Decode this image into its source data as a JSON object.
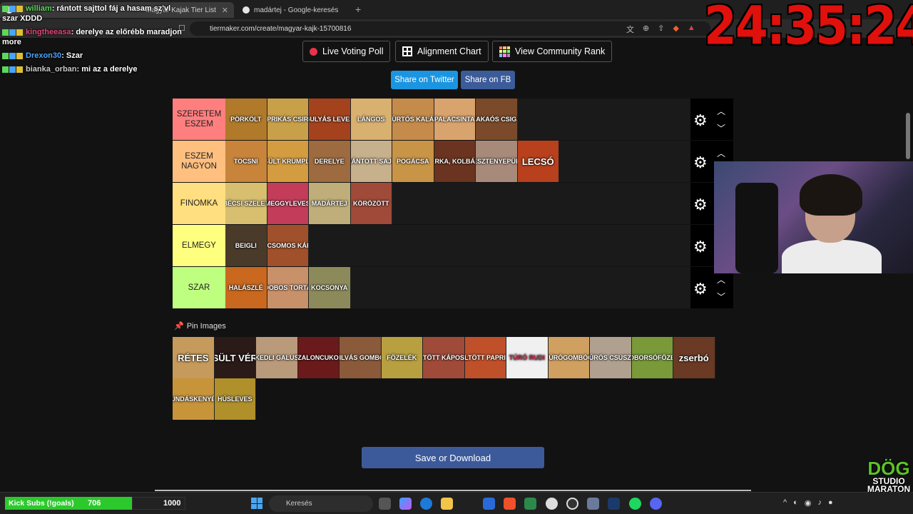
{
  "browser": {
    "tabs": [
      {
        "label": "Magyar Kajak Tier List",
        "active": true
      },
      {
        "label": "madártej - Google-keresés",
        "active": false
      }
    ],
    "url": "tiermaker.com/create/magyar-kajk-15700816"
  },
  "toolbar": {
    "live_voting": "Live Voting Poll",
    "alignment_chart": "Alignment Chart",
    "community_rank": "View Community Rank",
    "share_twitter": "Share on Twitter",
    "share_fb": "Share on FB",
    "twitter_color": "#1b95e0",
    "fb_color": "#3b5b99"
  },
  "tiers": [
    {
      "label": "SZERETEM ESZEM",
      "color": "#ff7f7f",
      "items": [
        {
          "text": "PÖRKÖLT",
          "bg": "#b07a2a"
        },
        {
          "text": "PRIKÁS CSIR",
          "bg": "#c9a04a"
        },
        {
          "text": "GULYÁS LEVES",
          "bg": "#a4421e"
        },
        {
          "text": "LÁNGOS",
          "bg": "#d8b070"
        },
        {
          "text": "KÜRTŐS KALÁC",
          "bg": "#c58b4b"
        },
        {
          "text": "PALACSINTA",
          "bg": "#d9a36d"
        },
        {
          "text": "KAKAÓS CSIGA",
          "bg": "#7a4a2a"
        }
      ]
    },
    {
      "label": "ESZEM NAGYON",
      "color": "#ffbf7f",
      "items": [
        {
          "text": "TOCSNI",
          "bg": "#c8843a"
        },
        {
          "text": "SÜLT KRUMPLI",
          "bg": "#d49c40"
        },
        {
          "text": "DERELYE",
          "bg": "#9e6a3f"
        },
        {
          "text": "RÁNTOTT SAJT",
          "bg": "#c7b08c"
        },
        {
          "text": "POGÁCSA",
          "bg": "#c89446"
        },
        {
          "text": "PÁRKA, KOLBÁSZ",
          "bg": "#6a3420"
        },
        {
          "text": "GESZTENYEPÜRÉ",
          "bg": "#a88a7a"
        },
        {
          "text": "LECSÓ",
          "bg": "#b8401c",
          "big": true
        }
      ]
    },
    {
      "label": "FINOMKA",
      "color": "#ffdf7f",
      "items": [
        {
          "text": "BÉCSI SZELET",
          "bg": "#d7bf6f"
        },
        {
          "text": "MEGGYLEVES",
          "bg": "#c33c5a"
        },
        {
          "text": "MADÁRTEJ",
          "bg": "#bfae7a"
        },
        {
          "text": "KÖRÖZÖTT",
          "bg": "#a04a3a"
        }
      ]
    },
    {
      "label": "ELMEGY",
      "color": "#ffff7f",
      "items": [
        {
          "text": "BEIGLI",
          "bg": "#4a3a2a"
        },
        {
          "text": "PARADICSOMOS KÁPOSZTA",
          "bg": "#a0502a"
        }
      ]
    },
    {
      "label": "SZAR",
      "color": "#bfff7f",
      "items": [
        {
          "text": "HALÁSZLÉ",
          "bg": "#c9681e"
        },
        {
          "text": "DOBOS TORTA",
          "bg": "#c9916a"
        },
        {
          "text": "KOCSONYA",
          "bg": "#8c8a5a"
        }
      ]
    }
  ],
  "pin_label": "Pin Images",
  "pool": [
    {
      "text": "RÉTES",
      "bg": "#c69a5a",
      "big": true
    },
    {
      "text": "SÜLT VÉR",
      "bg": "#2a1a18",
      "big": true
    },
    {
      "text": "NOKEDLI GALUSKA",
      "bg": "#b99a7a"
    },
    {
      "text": "SZALONCUKOR",
      "bg": "#6a1a1a"
    },
    {
      "text": "SZILVÁS GOMBÓC",
      "bg": "#8a5a3a"
    },
    {
      "text": "FŐZELÉK",
      "bg": "#b8a040"
    },
    {
      "text": "TÖLTÖTT KÁPOSZTA",
      "bg": "#a04a3a"
    },
    {
      "text": "TÖLTÖTT PAPRIKA",
      "bg": "#c0502a"
    },
    {
      "text": "TÚRÓ RUDI",
      "bg": "#f0f0f0"
    },
    {
      "text": "TÚRÓGOMBÓC",
      "bg": "#d0a060"
    },
    {
      "text": "TÚRÓS CSUSZA",
      "bg": "#b0a090"
    },
    {
      "text": "ZÖLDBORSÓFŐZELÉK",
      "bg": "#7a9a3a"
    },
    {
      "text": "zserbó",
      "bg": "#6a3a24",
      "big": true
    },
    {
      "text": "BUNDÁSKENYÉR",
      "bg": "#c8943a"
    },
    {
      "text": "HÚSLEVES",
      "bg": "#b0902a"
    }
  ],
  "save_label": "Save or Download",
  "chat": [
    {
      "user": "william",
      "user_color": "#5bd75b",
      "message": "rántott sajttol fáj a hasam sz'vl szar XDDD"
    },
    {
      "user": "kingtheeasa",
      "user_color": "#e0457b",
      "message": "derelye az előrébb maradjon more"
    },
    {
      "user": "Drexon30",
      "user_color": "#4aa3ff",
      "message": "Szar"
    },
    {
      "user": "bianka_orban",
      "user_color": "#c9c9c9",
      "message": "mi az a derelye"
    }
  ],
  "timer": "24:35:24",
  "subs": {
    "label": "Kick Subs (!goals)",
    "count": "706",
    "goal": "1000",
    "progress": 0.706
  },
  "taskbar": {
    "search_placeholder": "Keresés"
  },
  "logo": {
    "line1": "DÖG",
    "line2": "STUDIO",
    "line3": "MARATON"
  }
}
